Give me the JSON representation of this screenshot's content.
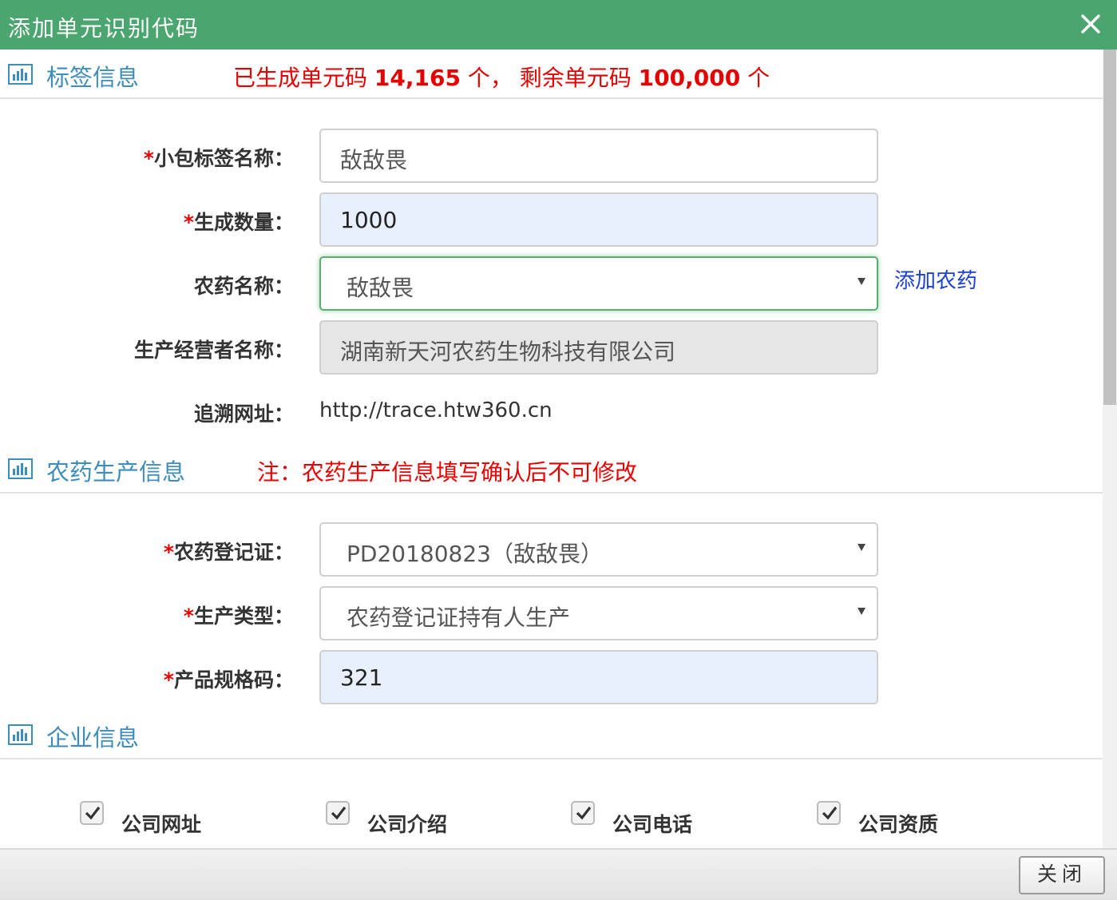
{
  "dialog": {
    "title": "添加单元识别代码",
    "close_icon": "close-icon",
    "accent": "#4aa56f"
  },
  "section_label": {
    "title": "标签信息",
    "note_prefix": "已生成单元码 ",
    "generated_count": "14,165",
    "note_mid": " 个，  剩余单元码 ",
    "remaining_count": "100,000",
    "note_suffix": " 个"
  },
  "fields": {
    "package_label_name": {
      "label": "小包标签名称：",
      "required": "*",
      "value": "敌敌畏"
    },
    "quantity": {
      "label": "生成数量：",
      "required": "*",
      "value": "1000"
    },
    "pesticide_name": {
      "label": "农药名称：",
      "value": "敌敌畏",
      "add_link": "添加农药"
    },
    "producer_name": {
      "label": "生产经营者名称：",
      "value": "湖南新天河农药生物科技有限公司"
    },
    "trace_url": {
      "label": "追溯网址：",
      "value": "http://trace.htw360.cn"
    }
  },
  "section_production": {
    "title": "农药生产信息",
    "note": "注：农药生产信息填写确认后不可修改"
  },
  "production": {
    "registration": {
      "label": "农药登记证：",
      "required": "*",
      "value": "PD20180823（敌敌畏）"
    },
    "production_type": {
      "label": "生产类型：",
      "required": "*",
      "value": "农药登记证持有人生产"
    },
    "spec_code": {
      "label": "产品规格码：",
      "required": "*",
      "value": "321"
    }
  },
  "section_company": {
    "title": "企业信息"
  },
  "company_checks": [
    {
      "label": "公司网址",
      "checked": true
    },
    {
      "label": "公司介绍",
      "checked": true
    },
    {
      "label": "公司电话",
      "checked": true
    },
    {
      "label": "公司资质",
      "checked": true
    }
  ],
  "footer": {
    "close_label": "关闭"
  }
}
